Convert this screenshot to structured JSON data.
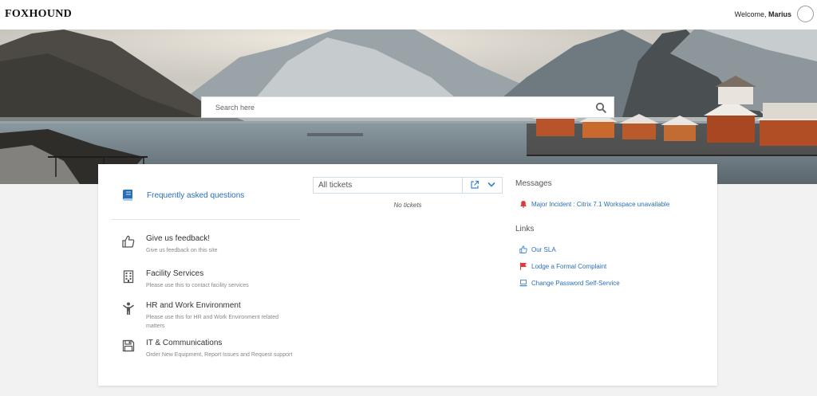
{
  "app": {
    "logo": "FOXHOUND",
    "welcome_prefix": "Welcome, ",
    "user_name": "Marius"
  },
  "search": {
    "placeholder": "Search here"
  },
  "faq": {
    "label": "Frequently asked questions"
  },
  "services": [
    {
      "title": "Give us feedback!",
      "desc": "Give us feedback on this site",
      "icon": "thumbs-up-icon"
    },
    {
      "title": "Facility Services",
      "desc": "Please use this to contact facility services",
      "icon": "building-icon"
    },
    {
      "title": "HR and Work Environment",
      "desc": "Please use this for HR and Work Environment related matters",
      "icon": "person-icon"
    },
    {
      "title": "IT & Communications",
      "desc": "Order New Equipment, Report Issues and Request support",
      "icon": "floppy-disk-icon"
    }
  ],
  "tickets": {
    "selected": "All tickets",
    "empty": "No tickets"
  },
  "messages": {
    "heading": "Messages",
    "items": [
      {
        "label": "Major Incident : Citrix 7.1 Workspace unavailable",
        "icon": "bell-icon"
      }
    ]
  },
  "links": {
    "heading": "Links",
    "items": [
      {
        "label": "Our SLA",
        "icon": "thumbs-up-icon"
      },
      {
        "label": "Lodge a Formal Complaint",
        "icon": "flag-icon"
      },
      {
        "label": "Change Password Self-Service",
        "icon": "laptop-icon"
      }
    ]
  },
  "colors": {
    "link": "#2a6fb5",
    "alert": "#e03a3a",
    "card": "#ffffff",
    "page_bg": "#f2f2f2"
  }
}
